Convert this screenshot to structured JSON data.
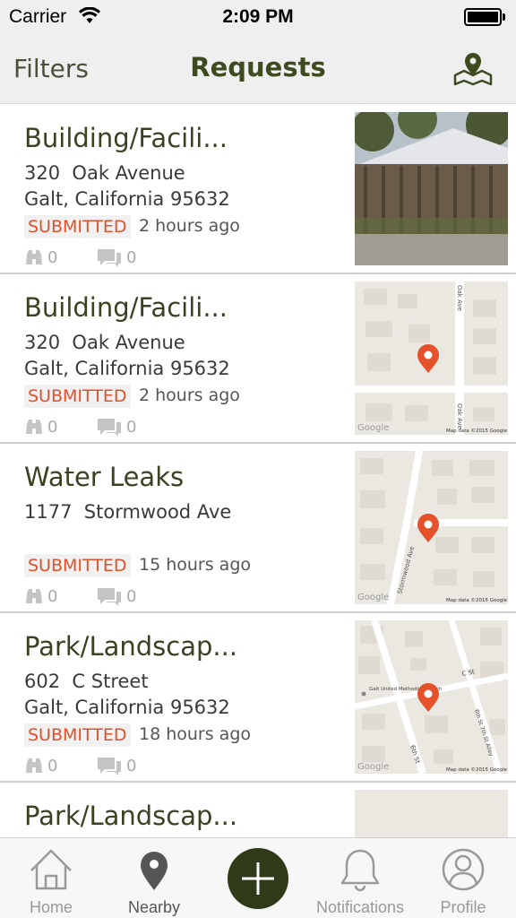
{
  "status_bar": {
    "carrier": "Carrier",
    "time": "2:09 PM"
  },
  "nav": {
    "filters_label": "Filters",
    "title": "Requests",
    "map_icon": "map-pin-icon"
  },
  "requests": [
    {
      "title": "Building/Facili...",
      "address_line1": "320  Oak Avenue",
      "address_line2": "Galt, California 95632",
      "status": "SUBMITTED",
      "age": "2 hours ago",
      "follows": "0",
      "comments": "0",
      "thumbnail": "photo"
    },
    {
      "title": "Building/Facili...",
      "address_line1": "320  Oak Avenue",
      "address_line2": "Galt, California 95632",
      "status": "SUBMITTED",
      "age": "2 hours ago",
      "follows": "0",
      "comments": "0",
      "thumbnail": "map",
      "map": {
        "streets": [
          "Oak Ave",
          "Oak Ave"
        ],
        "credit": "Map data ©2015 Google",
        "logo": "Google"
      }
    },
    {
      "title": "Water Leaks",
      "address_line1": "1177  Stormwood Ave",
      "address_line2": "",
      "status": "SUBMITTED",
      "age": "15 hours ago",
      "follows": "0",
      "comments": "0",
      "thumbnail": "map",
      "map": {
        "streets": [
          "Stormwood Ave"
        ],
        "credit": "Map data ©2015 Google",
        "logo": "Google"
      }
    },
    {
      "title": "Park/Landscap...",
      "address_line1": "602  C Street",
      "address_line2": "Galt, California 95632",
      "status": "SUBMITTED",
      "age": "18 hours ago",
      "follows": "0",
      "comments": "0",
      "thumbnail": "map",
      "map": {
        "streets": [
          "C St",
          "6th St",
          "6th St 7th St Alley"
        ],
        "poi": "Galt United Methodist Church",
        "credit": "Map data ©2015 Google",
        "logo": "Google"
      }
    },
    {
      "title": "Park/Landscap...",
      "thumbnail": "map"
    }
  ],
  "tabs": [
    {
      "label": "Home",
      "icon": "home-icon"
    },
    {
      "label": "Nearby",
      "icon": "location-pin-icon",
      "active": true
    },
    {
      "label": "",
      "icon": "plus-icon"
    },
    {
      "label": "Notifications",
      "icon": "bell-icon"
    },
    {
      "label": "Profile",
      "icon": "profile-icon"
    }
  ],
  "colors": {
    "accent": "#2f3a19",
    "status": "#e0512b",
    "title": "#3a4222",
    "map_bg": "#ebe8e1",
    "pin": "#e4512b"
  }
}
